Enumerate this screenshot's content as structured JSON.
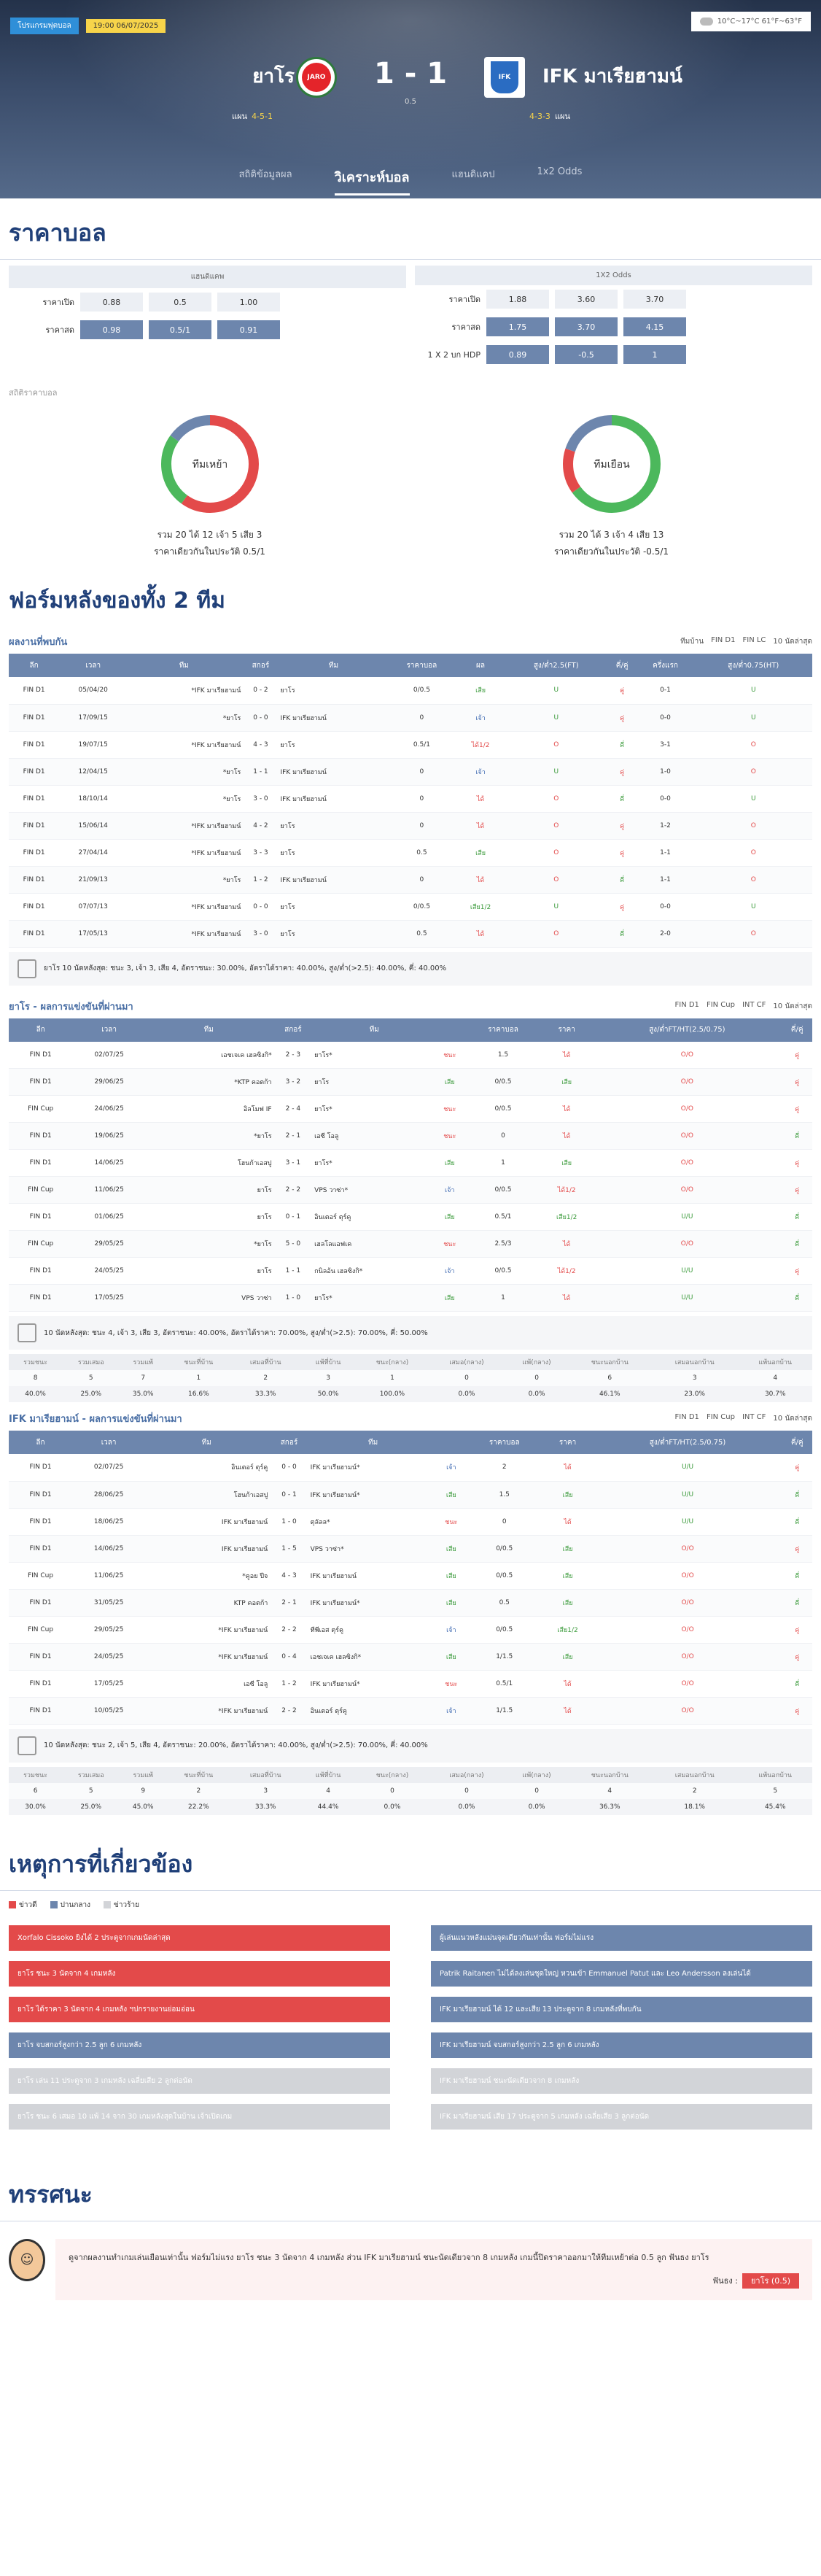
{
  "header": {
    "league_badge": "โปรแกรมฟุตบอล",
    "datetime": "19:00 06/07/2025",
    "weather": "10°C~17°C 61°F~63°F",
    "home": "ยาโร",
    "away": "IFK มาเรียฮามน์",
    "score": "1 - 1",
    "handicap": "0.5",
    "home_form_label": "แผน",
    "home_form": "4-5-1",
    "away_form_label": "แผน",
    "away_form": "4-3-3",
    "tabs": [
      "สถิติข้อมูลผล",
      "วิเคราะห์บอล",
      "แฮนดิแคป",
      "1x2 Odds"
    ]
  },
  "odds": {
    "title": "ราคาบอล",
    "left_head": "แฮนดิแคพ",
    "right_head": "1X2 Odds",
    "open_label": "ราคาเปิด",
    "close_label": "ราคาสด",
    "hdp_label": "1 X 2 บก HDP",
    "left_open": [
      "0.88",
      "0.5",
      "1.00"
    ],
    "left_close": [
      "0.98",
      "0.5/1",
      "0.91"
    ],
    "right_open": [
      "1.88",
      "3.60",
      "3.70"
    ],
    "right_close": [
      "1.75",
      "3.70",
      "4.15"
    ],
    "right_hdp": [
      "0.89",
      "-0.5",
      "1"
    ]
  },
  "stats": {
    "label": "สถิติราคาบอล",
    "home": {
      "center": "ทีมเหย้า",
      "summary": "รวม 20 ได้ 12 เจ้า 5 เสีย 3",
      "line2": "ราคาเดียวกันในประวัติ 0.5/1"
    },
    "away": {
      "center": "ทีมเยือน",
      "summary": "รวม 20 ได้ 3 เจ้า 4 เสีย 13",
      "line2": "ราคาเดียวกันในประวัติ -0.5/1"
    }
  },
  "form": {
    "title": "ฟอร์มหลังของทั้ง 2 ทีม",
    "h2h_title": "ผลงานที่พบกัน",
    "filters": [
      "ทีมบ้าน",
      "FIN D1",
      "FIN LC",
      "10 นัดล่าสุด"
    ],
    "h2h_head": [
      "ลีก",
      "เวลา",
      "ทีม",
      "สกอร์",
      "ทีม",
      "ราคาบอล",
      "ผล",
      "สูง/ต่ำ2.5(FT)",
      "คี่/คู่",
      "ครึ่งแรก",
      "สูง/ต่ำ0.75(HT)"
    ],
    "h2h_rows": [
      [
        "FIN D1",
        "05/04/20",
        "*IFK มาเรียฮามน์",
        "0 - 2",
        "ยาโร",
        "0/0.5",
        "เสีย",
        "U",
        "คู่",
        "0-1",
        "U"
      ],
      [
        "FIN D1",
        "17/09/15",
        "*ยาโร",
        "0 - 0",
        "IFK มาเรียฮามน์",
        "0",
        "เจ้า",
        "U",
        "คู่",
        "0-0",
        "U"
      ],
      [
        "FIN D1",
        "19/07/15",
        "*IFK มาเรียฮามน์",
        "4 - 3",
        "ยาโร",
        "0.5/1",
        "ได้1/2",
        "O",
        "คี่",
        "3-1",
        "O"
      ],
      [
        "FIN D1",
        "12/04/15",
        "*ยาโร",
        "1 - 1",
        "IFK มาเรียฮามน์",
        "0",
        "เจ้า",
        "U",
        "คู่",
        "1-0",
        "O"
      ],
      [
        "FIN D1",
        "18/10/14",
        "*ยาโร",
        "3 - 0",
        "IFK มาเรียฮามน์",
        "0",
        "ได้",
        "O",
        "คี่",
        "0-0",
        "U"
      ],
      [
        "FIN D1",
        "15/06/14",
        "*IFK มาเรียฮามน์",
        "4 - 2",
        "ยาโร",
        "0",
        "ได้",
        "O",
        "คู่",
        "1-2",
        "O"
      ],
      [
        "FIN D1",
        "27/04/14",
        "*IFK มาเรียฮามน์",
        "3 - 3",
        "ยาโร",
        "0.5",
        "เสีย",
        "O",
        "คู่",
        "1-1",
        "O"
      ],
      [
        "FIN D1",
        "21/09/13",
        "*ยาโร",
        "1 - 2",
        "IFK มาเรียฮามน์",
        "0",
        "ได้",
        "O",
        "คี่",
        "1-1",
        "O"
      ],
      [
        "FIN D1",
        "07/07/13",
        "*IFK มาเรียฮามน์",
        "0 - 0",
        "ยาโร",
        "0/0.5",
        "เสีย1/2",
        "U",
        "คู่",
        "0-0",
        "U"
      ],
      [
        "FIN D1",
        "17/05/13",
        "*IFK มาเรียฮามน์",
        "3 - 0",
        "ยาโร",
        "0.5",
        "ได้",
        "O",
        "คี่",
        "2-0",
        "O"
      ]
    ],
    "h2h_summary": "ยาโร 10 นัดหลังสุด: ชนะ 3, เจ้า 3, เสีย 4, อัตราชนะ: 30.00%, อัตราได้ราคา: 40.00%, สูง/ต่ำ(>2.5): 40.00%, คี่: 40.00%",
    "home_title": "ยาโร - ผลการแข่งขันที่ผ่านมา",
    "home_filters": [
      "FIN D1",
      "FIN Cup",
      "INT CF",
      "10 นัดล่าสุด"
    ],
    "recent_head": [
      "ลีก",
      "เวลา",
      "ทีม",
      "สกอร์",
      "ทีม",
      "",
      "ราคาบอล",
      "ราคา",
      "สูง/ต่ำFT/HT(2.5/0.75)",
      "คี่/คู่"
    ],
    "home_rows": [
      [
        "FIN D1",
        "02/07/25",
        "เอชเจเค เฮลซิงกิ*",
        "2 - 3",
        "ยาโร*",
        "ชนะ",
        "1.5",
        "ได้",
        "O/O",
        "คู่"
      ],
      [
        "FIN D1",
        "29/06/25",
        "*KTP คอตก้า",
        "3 - 2",
        "ยาโร",
        "เสีย",
        "0/0.5",
        "เสีย",
        "O/O",
        "คู่"
      ],
      [
        "FIN Cup",
        "24/06/25",
        "อิลโมฟ IF",
        "2 - 4",
        "ยาโร*",
        "ชนะ",
        "0/0.5",
        "ได้",
        "O/O",
        "คู่"
      ],
      [
        "FIN D1",
        "19/06/25",
        "*ยาโร",
        "2 - 1",
        "เอซี โอลู",
        "ชนะ",
        "0",
        "ได้",
        "O/O",
        "คี่"
      ],
      [
        "FIN D1",
        "14/06/25",
        "โฮนก้าเอสปู",
        "3 - 1",
        "ยาโร*",
        "เสีย",
        "1",
        "เสีย",
        "O/O",
        "คู่"
      ],
      [
        "FIN Cup",
        "11/06/25",
        "ยาโร",
        "2 - 2",
        "VPS วาซ่า*",
        "เจ้า",
        "0/0.5",
        "ได้1/2",
        "O/O",
        "คู่"
      ],
      [
        "FIN D1",
        "01/06/25",
        "ยาโร",
        "0 - 1",
        "อินเตอร์ ตุร์คู",
        "เสีย",
        "0.5/1",
        "เสีย1/2",
        "U/U",
        "คี่"
      ],
      [
        "FIN Cup",
        "29/05/25",
        "*ยาโร",
        "5 - 0",
        "เฮลโลแอฟเค",
        "ชนะ",
        "2.5/3",
        "ได้",
        "O/O",
        "คี่"
      ],
      [
        "FIN D1",
        "24/05/25",
        "ยาโร",
        "1 - 1",
        "กนิลอ้น เฮลซิงกิ*",
        "เจ้า",
        "0/0.5",
        "ได้1/2",
        "U/U",
        "คู่"
      ],
      [
        "FIN D1",
        "17/05/25",
        "VPS วาซ่า",
        "1 - 0",
        "ยาโร*",
        "เสีย",
        "1",
        "ได้",
        "U/U",
        "คี่"
      ]
    ],
    "home_summary": "10 นัดหลังสุด: ชนะ 4, เจ้า 3, เสีย 3, อัตราชนะ: 40.00%, อัตราได้ราคา: 70.00%, สูง/ต่ำ(>2.5): 70.00%, คี่: 50.00%",
    "mini_head": [
      "รวมชนะ",
      "รวมเสมอ",
      "รวมแพ้",
      "ชนะที่บ้าน",
      "เสมอที่บ้าน",
      "แพ้ที่บ้าน",
      "ชนะ(กลาง)",
      "เสมอ(กลาง)",
      "แพ้(กลาง)",
      "ชนะนอกบ้าน",
      "เสมอนอกบ้าน",
      "แพ้นอกบ้าน"
    ],
    "home_mini": [
      "8",
      "5",
      "7",
      "1",
      "2",
      "3",
      "1",
      "0",
      "0",
      "6",
      "3",
      "4"
    ],
    "home_mini_pct": [
      "40.0%",
      "25.0%",
      "35.0%",
      "16.6%",
      "33.3%",
      "50.0%",
      "100.0%",
      "0.0%",
      "0.0%",
      "46.1%",
      "23.0%",
      "30.7%"
    ],
    "away_title": "IFK มาเรียฮามน์ - ผลการแข่งขันที่ผ่านมา",
    "away_rows": [
      [
        "FIN D1",
        "02/07/25",
        "อินเตอร์ ตุร์คู",
        "0 - 0",
        "IFK มาเรียฮามน์*",
        "เจ้า",
        "2",
        "ได้",
        "U/U",
        "คู่"
      ],
      [
        "FIN D1",
        "28/06/25",
        "โฮนก้าเอสปู",
        "0 - 1",
        "IFK มาเรียฮามน์*",
        "เสีย",
        "1.5",
        "เสีย",
        "U/U",
        "คี่"
      ],
      [
        "FIN D1",
        "18/06/25",
        "IFK มาเรียฮามน์",
        "1 - 0",
        "ตุลัลล*",
        "ชนะ",
        "0",
        "ได้",
        "U/U",
        "คี่"
      ],
      [
        "FIN D1",
        "14/06/25",
        "IFK มาเรียฮามน์",
        "1 - 5",
        "VPS วาซ่า*",
        "เสีย",
        "0/0.5",
        "เสีย",
        "O/O",
        "คู่"
      ],
      [
        "FIN Cup",
        "11/06/25",
        "*คูอย ปีจ",
        "4 - 3",
        "IFK มาเรียฮามน์",
        "เสีย",
        "0/0.5",
        "เสีย",
        "O/O",
        "คี่"
      ],
      [
        "FIN D1",
        "31/05/25",
        "KTP คอตก้า",
        "2 - 1",
        "IFK มาเรียฮามน์*",
        "เสีย",
        "0.5",
        "เสีย",
        "O/O",
        "คี่"
      ],
      [
        "FIN Cup",
        "29/05/25",
        "*IFK มาเรียฮามน์",
        "2 - 2",
        "ทีพีเอส ตุร์คู",
        "เจ้า",
        "0/0.5",
        "เสีย1/2",
        "O/O",
        "คู่"
      ],
      [
        "FIN D1",
        "24/05/25",
        "*IFK มาเรียฮามน์",
        "0 - 4",
        "เอชเจเค เฮลซิงกิ*",
        "เสีย",
        "1/1.5",
        "เสีย",
        "O/O",
        "คู่"
      ],
      [
        "FIN D1",
        "17/05/25",
        "เอซี โอลู",
        "1 - 2",
        "IFK มาเรียฮามน์*",
        "ชนะ",
        "0.5/1",
        "ได้",
        "O/O",
        "คี่"
      ],
      [
        "FIN D1",
        "10/05/25",
        "*IFK มาเรียฮามน์",
        "2 - 2",
        "อินเตอร์ ตุร์คู",
        "เจ้า",
        "1/1.5",
        "ได้",
        "O/O",
        "คู่"
      ]
    ],
    "away_summary": "10 นัดหลังสุด: ชนะ 2, เจ้า 5, เสีย 4, อัตราชนะ: 20.00%, อัตราได้ราคา: 40.00%, สูง/ต่ำ(>2.5): 70.00%, คี่: 40.00%",
    "away_mini": [
      "6",
      "5",
      "9",
      "2",
      "3",
      "4",
      "0",
      "0",
      "0",
      "4",
      "2",
      "5"
    ],
    "away_mini_pct": [
      "30.0%",
      "25.0%",
      "45.0%",
      "22.2%",
      "33.3%",
      "44.4%",
      "0.0%",
      "0.0%",
      "0.0%",
      "36.3%",
      "18.1%",
      "45.4%"
    ]
  },
  "events": {
    "title": "เหตุการที่เกี่ยวข้อง",
    "legend": [
      "ข่าวดี",
      "ปานกลาง",
      "ข่าวร้าย"
    ],
    "left": [
      [
        "r",
        "Xorfalo Cissoko ยิงได้ 2 ประตูจากเกมนัดล่าสุด"
      ],
      [
        "r",
        "ยาโร ชนะ 3 นัดจาก 4 เกมหลัง"
      ],
      [
        "r",
        "ยาโร ได้ราคา 3 นัดจาก 4 เกมหลัง ฯปกรายงานย่อมอ่อน"
      ],
      [
        "b",
        "ยาโร จบสกอร์สูงกว่า 2.5 ลูก 6 เกมหลัง"
      ],
      [
        "g",
        "ยาโร เล่น 11 ประตูจาก 3 เกมหลัง เฉลี่ยเสีย 2 ลูกต่อนัด"
      ],
      [
        "g",
        "ยาโร ชนะ 6 เสมอ 10 แพ้ 14 จาก 30 เกมหลังสุดในบ้าน เจ้าเปิดเกม"
      ]
    ],
    "right": [
      [
        "b",
        "ผู้เล่นแนวหลังแม่นจุดเดียวกันเท่านั้น ฟอร์มไม่แรง"
      ],
      [
        "b",
        "Patrik Raitanen ไม่ได้ลงเล่นชุดใหญ่ หวนเข้า Emmanuel Patut และ Leo Andersson ลงเล่นได้"
      ],
      [
        "b",
        "IFK มาเรียฮามน์ ได้ 12 และเสีย 13 ประตูจาก 8 เกมหลังที่พบกัน"
      ],
      [
        "b",
        "IFK มาเรียฮามน์ จบสกอร์สูงกว่า 2.5 ลูก 6 เกมหลัง"
      ],
      [
        "g",
        "IFK มาเรียฮามน์ ชนะนัดเดียวจาก 8 เกมหลัง"
      ],
      [
        "g",
        "IFK มาเรียฮามน์ เสีย 17 ประตูจาก 5 เกมหลัง เฉลี่ยเสีย 3 ลูกต่อนัด"
      ]
    ]
  },
  "comment": {
    "title": "ทรรศนะ",
    "text": "ดูจากผลงานทำเกมเล่นเยือนเท่านั้น ฟอร์มไม่แรง ยาโร ชนะ 3 นัดจาก 4 เกมหลัง ส่วน IFK มาเรียฮามน์ ชนะนัดเดียวจาก 8 เกมหลัง เกมนี้ปิดราคาออกมาให้ทีมเหย้าต่อ 0.5 ลูก ฟันธง ยาโร",
    "pick_label": "ฟันธง :",
    "pick": "ยาโร (0.5)"
  },
  "colors": {
    "accent": "#1f3f78",
    "header": "#6d86ad",
    "good": "#e34a4a",
    "mid": "#6d86ad",
    "bad": "#d2d4d8"
  }
}
